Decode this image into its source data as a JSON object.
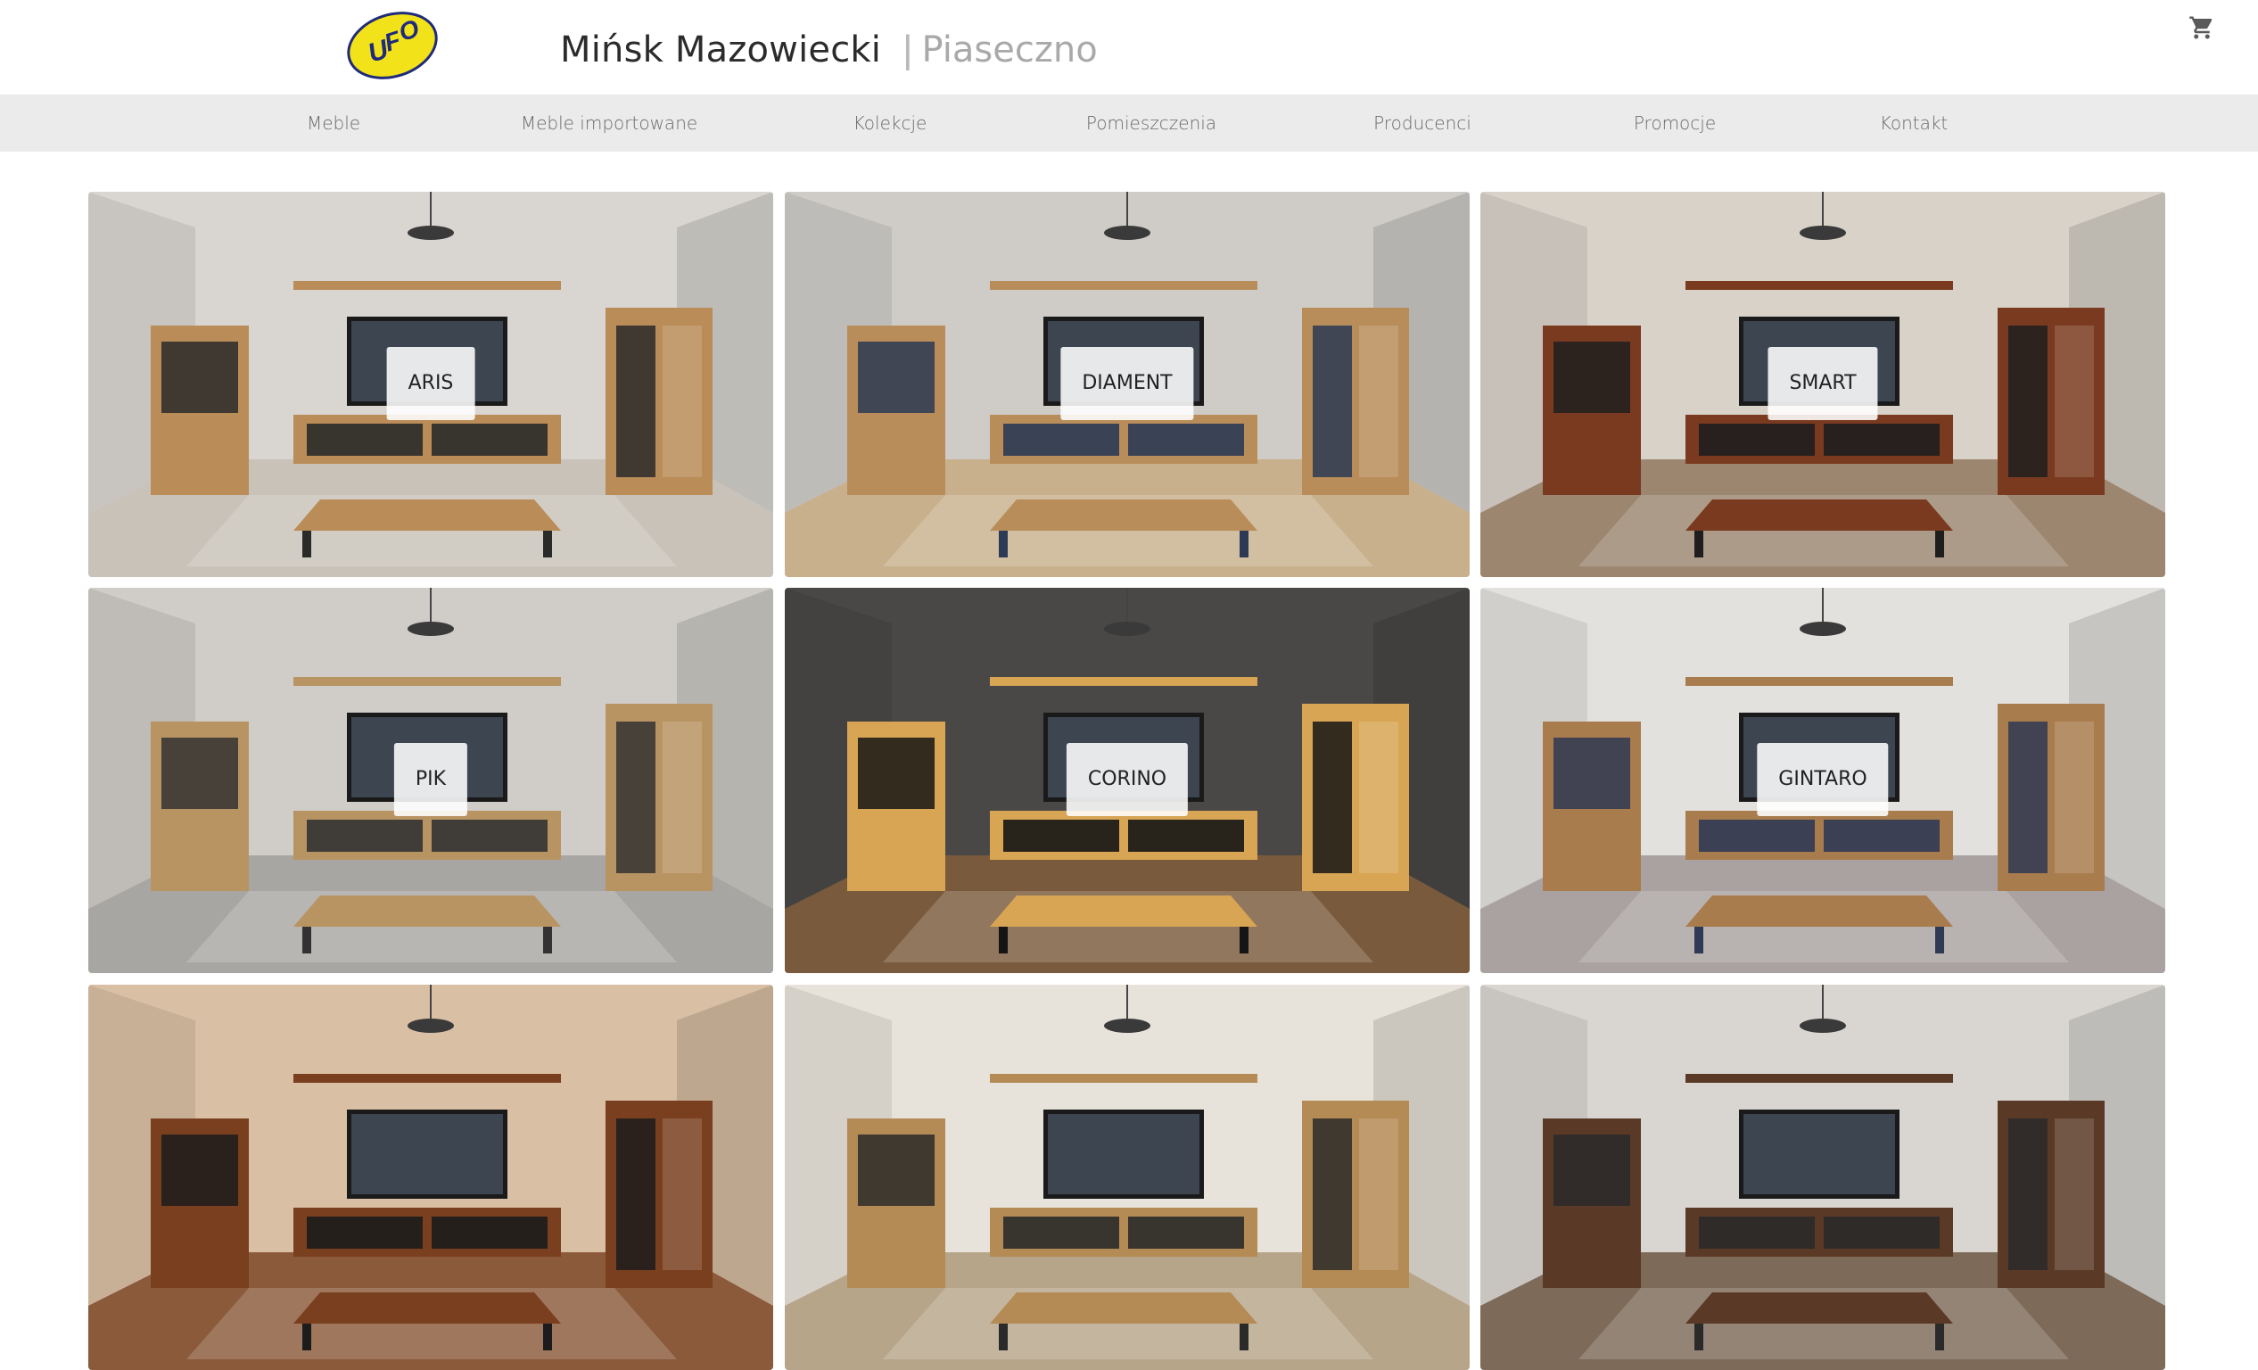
{
  "header": {
    "logo_text": "UFO",
    "city_primary": "Mińsk Mazowiecki",
    "separator": "|",
    "city_secondary": "Piaseczno",
    "cart_icon": "cart-icon"
  },
  "nav": {
    "items": [
      {
        "label": "Meble"
      },
      {
        "label": "Meble importowane"
      },
      {
        "label": "Kolekcje"
      },
      {
        "label": "Pomieszczenia"
      },
      {
        "label": "Producenci"
      },
      {
        "label": "Promocje"
      },
      {
        "label": "Kontakt"
      }
    ]
  },
  "collections": [
    {
      "label": "ARIS",
      "palette": {
        "wall": "#d9d6d1",
        "floor": "#c9c2b8",
        "wood": "#b98c58",
        "accent": "#2a2a2a"
      }
    },
    {
      "label": "DIAMENT",
      "palette": {
        "wall": "#cfccc8",
        "floor": "#c8b08c",
        "wood": "#b98d5a",
        "accent": "#2c3a55"
      }
    },
    {
      "label": "SMART",
      "palette": {
        "wall": "#d8d2c9",
        "floor": "#9c8670",
        "wood": "#7a3a1f",
        "accent": "#1e1e1e"
      }
    },
    {
      "label": "PIK",
      "palette": {
        "wall": "#d0cdc8",
        "floor": "#a8a6a3",
        "wood": "#b99463",
        "accent": "#333333"
      }
    },
    {
      "label": "CORINO",
      "palette": {
        "wall": "#4a4846",
        "floor": "#7a5a3c",
        "wood": "#d7a553",
        "accent": "#151515"
      }
    },
    {
      "label": "GINTARO",
      "palette": {
        "wall": "#e3e1dd",
        "floor": "#a9a2a0",
        "wood": "#a97c4d",
        "accent": "#2f3a55"
      }
    },
    {
      "label": "",
      "palette": {
        "wall": "#d9bfa3",
        "floor": "#8a5a3a",
        "wood": "#7a3f1f",
        "accent": "#1c1c1c"
      }
    },
    {
      "label": "",
      "palette": {
        "wall": "#e8e3da",
        "floor": "#b7a58a",
        "wood": "#b48a55",
        "accent": "#2a2a2a"
      }
    },
    {
      "label": "",
      "palette": {
        "wall": "#d9d6d2",
        "floor": "#7d6a58",
        "wood": "#5a3a26",
        "accent": "#2a2a2a"
      }
    }
  ]
}
